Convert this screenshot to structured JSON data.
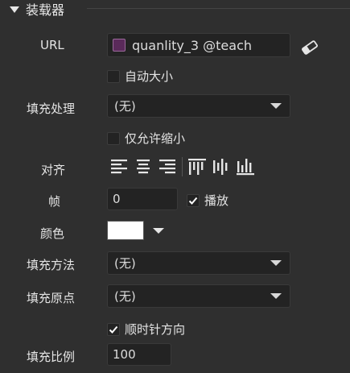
{
  "section": {
    "title": "装载器"
  },
  "url": {
    "label": "URL",
    "value": "quanlity_3 @teach",
    "swatch_color": "#5a2a5a"
  },
  "auto_size": {
    "label": "自动大小",
    "checked": false
  },
  "fill_process": {
    "label": "填充处理",
    "value": "(无)"
  },
  "shrink_only": {
    "label": "仅允许缩小",
    "checked": false
  },
  "align": {
    "label": "对齐"
  },
  "frame": {
    "label": "帧",
    "value": "0"
  },
  "play": {
    "label": "播放",
    "checked": true
  },
  "color": {
    "label": "颜色",
    "value": "#ffffff"
  },
  "fill_method": {
    "label": "填充方法",
    "value": "(无)"
  },
  "fill_origin": {
    "label": "填充原点",
    "value": "(无)"
  },
  "clockwise": {
    "label": "顺时针方向",
    "checked": true
  },
  "fill_ratio": {
    "label": "填充比例",
    "value": "100"
  }
}
